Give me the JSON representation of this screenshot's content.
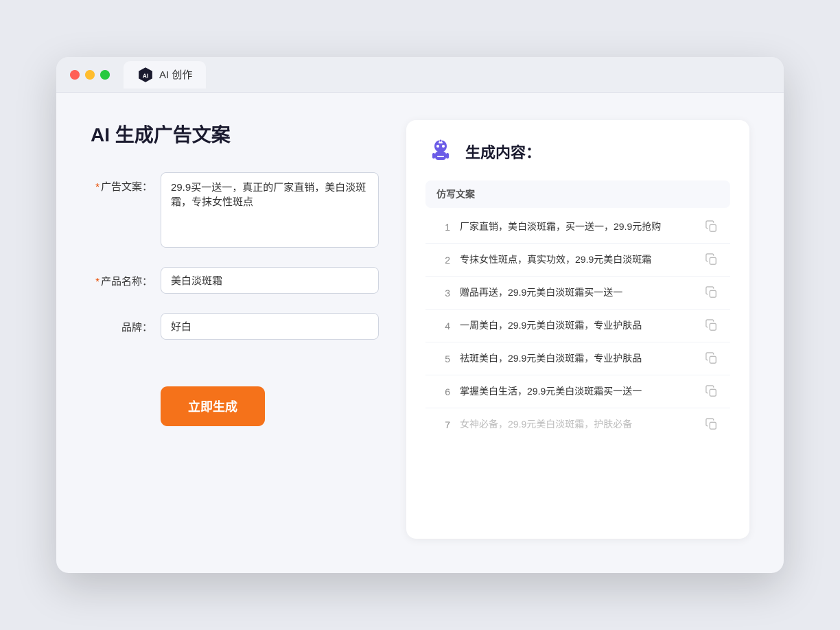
{
  "browser": {
    "tab_label": "AI 创作"
  },
  "page": {
    "title": "AI 生成广告文案",
    "result_title": "生成内容："
  },
  "form": {
    "ad_copy_label": "广告文案：",
    "ad_copy_required": true,
    "ad_copy_value": "29.9买一送一，真正的厂家直销，美白淡斑霜，专抹女性斑点",
    "product_name_label": "产品名称：",
    "product_name_required": true,
    "product_name_value": "美白淡斑霜",
    "brand_label": "品牌：",
    "brand_required": false,
    "brand_value": "好白",
    "generate_btn": "立即生成"
  },
  "results": {
    "column_header": "仿写文案",
    "items": [
      {
        "index": 1,
        "text": "厂家直销，美白淡斑霜，买一送一，29.9元抢购",
        "faded": false
      },
      {
        "index": 2,
        "text": "专抹女性斑点，真实功效，29.9元美白淡斑霜",
        "faded": false
      },
      {
        "index": 3,
        "text": "赠品再送，29.9元美白淡斑霜买一送一",
        "faded": false
      },
      {
        "index": 4,
        "text": "一周美白，29.9元美白淡斑霜，专业护肤品",
        "faded": false
      },
      {
        "index": 5,
        "text": "祛斑美白，29.9元美白淡斑霜，专业护肤品",
        "faded": false
      },
      {
        "index": 6,
        "text": "掌握美白生活，29.9元美白淡斑霜买一送一",
        "faded": false
      },
      {
        "index": 7,
        "text": "女神必备，29.9元美白淡斑霜，护肤必备",
        "faded": true
      }
    ]
  }
}
